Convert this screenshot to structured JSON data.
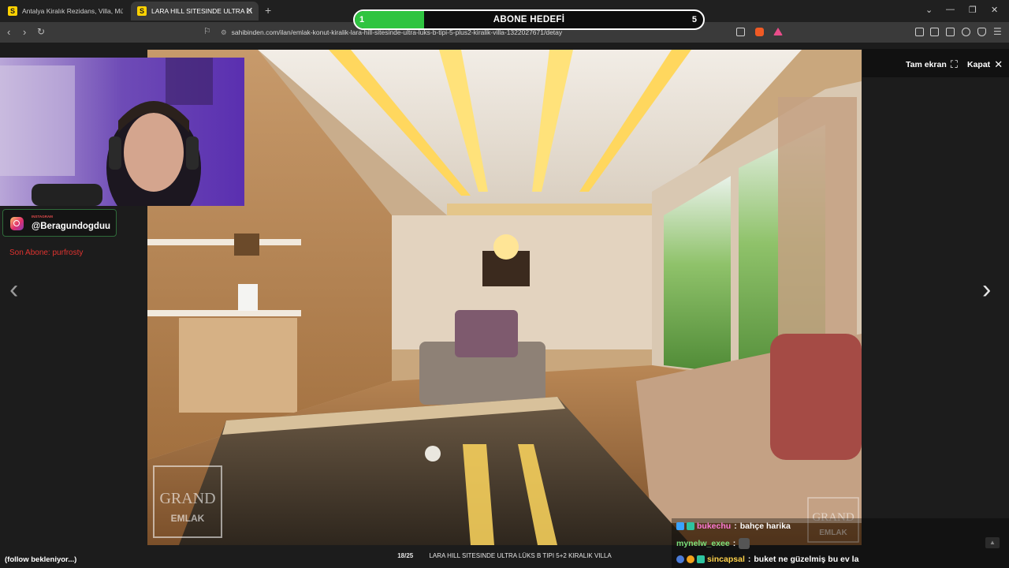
{
  "browser": {
    "tabs": [
      {
        "favicon": "S",
        "title": "Antalya Kiralık Rezidans, Villa, Müstaki"
      },
      {
        "favicon": "S",
        "title": "LARA HILL SITESINDE ULTRA LÜK"
      }
    ],
    "new_tab": "+",
    "url": "sahibinden.com/ilan/emlak-konut-kiralik-lara-hill-sitesinde-ultra-luks-b-tipi-5-plus2-kiralik-villa-1322027671/detay"
  },
  "goal": {
    "title": "ABONE HEDEFİ",
    "current": "1",
    "target": "5",
    "progress": 0.2,
    "color": "#2fc440"
  },
  "gallery": {
    "fullscreen_label": "Tam ekran",
    "close_label": "Kapat",
    "counter": "18/25",
    "caption": "LARA HILL SITESINDE ULTRA LÜKS B TIPI 5+2 KIRALIK VILLA",
    "watermark": "GRAND EMLAK"
  },
  "overlay": {
    "instagram_label": "INSTAGRAM",
    "instagram_handle": "@Beragundogduu",
    "last_sub": "Son Abone: purfrosty",
    "follow_status": "(follow bekleniyor...)"
  },
  "chat": [
    {
      "user": "bukechu",
      "text": "bahçe harika",
      "color": "#ff7ad9"
    },
    {
      "user": "mynelw_exee",
      "text": "",
      "color": "#7be07b"
    },
    {
      "user": "sincapsal",
      "text": "buket ne güzelmiş bu ev la",
      "color": "#ffd24a"
    }
  ]
}
